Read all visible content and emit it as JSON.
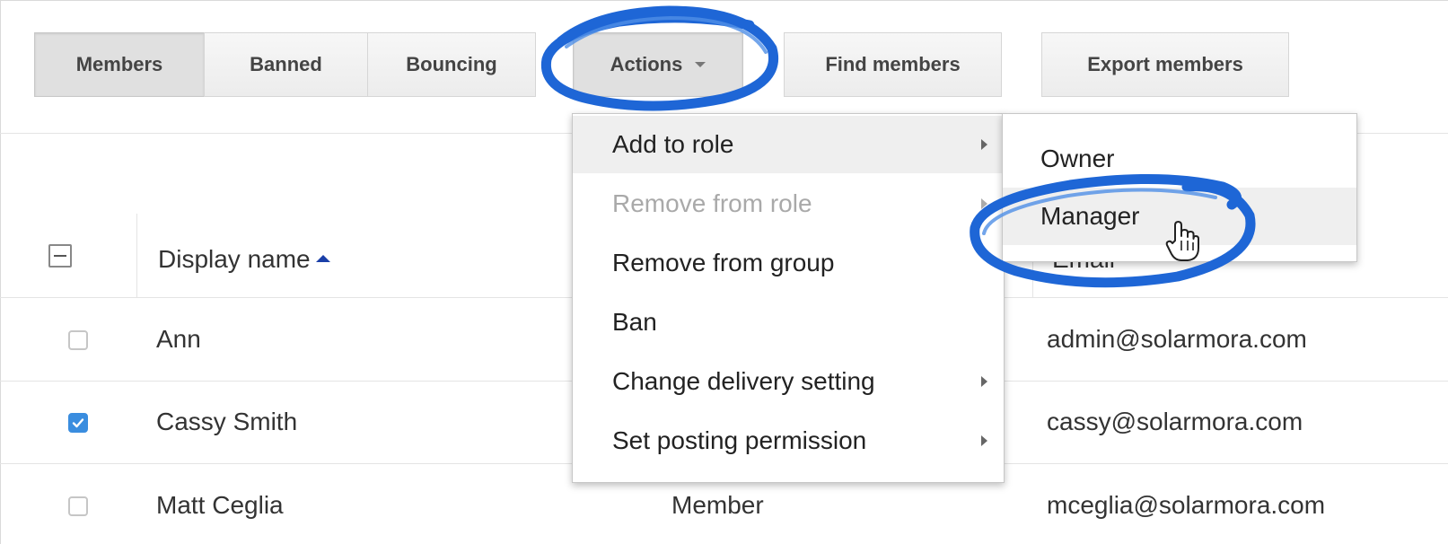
{
  "toolbar": {
    "tabs": [
      {
        "label": "Members",
        "active": true
      },
      {
        "label": "Banned",
        "active": false
      },
      {
        "label": "Bouncing",
        "active": false
      }
    ],
    "actions_label": "Actions",
    "find_members_label": "Find members",
    "export_members_label": "Export members"
  },
  "table": {
    "columns": {
      "display_name": "Display name",
      "role": "",
      "email": "Email"
    },
    "sort": "ascending",
    "rows": [
      {
        "name": "Ann",
        "role": "",
        "email": "admin@solarmora.com",
        "checked": false
      },
      {
        "name": "Cassy Smith",
        "role": "",
        "email": "cassy@solarmora.com",
        "checked": true
      },
      {
        "name": "Matt Ceglia",
        "role": "Member",
        "email": "mceglia@solarmora.com",
        "checked": false
      }
    ]
  },
  "actions_menu": {
    "items": [
      {
        "label": "Add to role",
        "submenu": true,
        "state": "hover"
      },
      {
        "label": "Remove from role",
        "submenu": true,
        "state": "disabled"
      },
      {
        "label": "Remove from group",
        "submenu": false,
        "state": "normal"
      },
      {
        "label": "Ban",
        "submenu": false,
        "state": "normal"
      },
      {
        "label": "Change delivery setting",
        "submenu": true,
        "state": "normal"
      },
      {
        "label": "Set posting permission",
        "submenu": true,
        "state": "normal"
      }
    ]
  },
  "role_submenu": {
    "items": [
      {
        "label": "Owner",
        "state": "normal"
      },
      {
        "label": "Manager",
        "state": "hover"
      }
    ]
  },
  "colors": {
    "annotation": "#1e66d6",
    "checkbox_checked": "#3a8ddf",
    "sort_arrow": "#1a3fa8"
  }
}
